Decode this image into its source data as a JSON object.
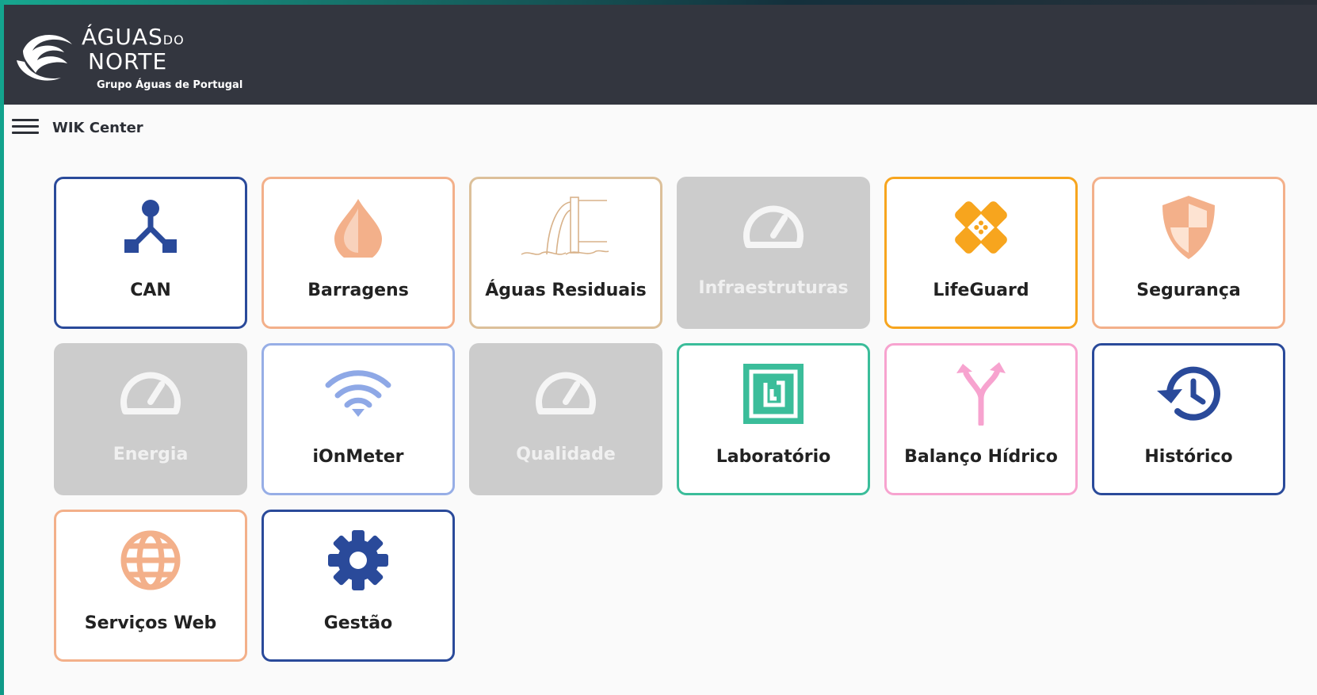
{
  "header": {
    "logo_line1": "ÁGUAS",
    "logo_line1_small": "DO",
    "logo_line2": "NORTE",
    "logo_line3": "Grupo Águas de Portugal"
  },
  "toolbar": {
    "title": "WIK Center"
  },
  "tiles": [
    {
      "label": "CAN",
      "icon": "network-icon",
      "color": "#2a4a9a",
      "enabled": true
    },
    {
      "label": "Barragens",
      "icon": "water-drop-icon",
      "color": "#f3b08a",
      "enabled": true
    },
    {
      "label": "Águas Residuais",
      "icon": "wastewater-pipe-icon",
      "color": "#dcc09a",
      "enabled": true
    },
    {
      "label": "Infraestruturas",
      "icon": "gauge-icon",
      "color": "#cccccc",
      "enabled": false
    },
    {
      "label": "LifeGuard",
      "icon": "bandage-icon",
      "color": "#f7a51e",
      "enabled": true
    },
    {
      "label": "Segurança",
      "icon": "shield-icon",
      "color": "#f3b08a",
      "enabled": true
    },
    {
      "label": "Energia",
      "icon": "gauge-icon",
      "color": "#cccccc",
      "enabled": false
    },
    {
      "label": "iOnMeter",
      "icon": "wifi-icon",
      "color": "#97aee6",
      "enabled": true
    },
    {
      "label": "Qualidade",
      "icon": "gauge-icon",
      "color": "#cccccc",
      "enabled": false
    },
    {
      "label": "Laboratório",
      "icon": "lab-square-icon",
      "color": "#3bbd9a",
      "enabled": true
    },
    {
      "label": "Balanço Hídrico",
      "icon": "split-arrows-icon",
      "color": "#f7a3cf",
      "enabled": true
    },
    {
      "label": "Histórico",
      "icon": "history-icon",
      "color": "#2a4a9a",
      "enabled": true
    },
    {
      "label": "Serviços Web",
      "icon": "globe-icon",
      "color": "#f3b08a",
      "enabled": true
    },
    {
      "label": "Gestão",
      "icon": "gear-icon",
      "color": "#2a4a9a",
      "enabled": true
    }
  ]
}
